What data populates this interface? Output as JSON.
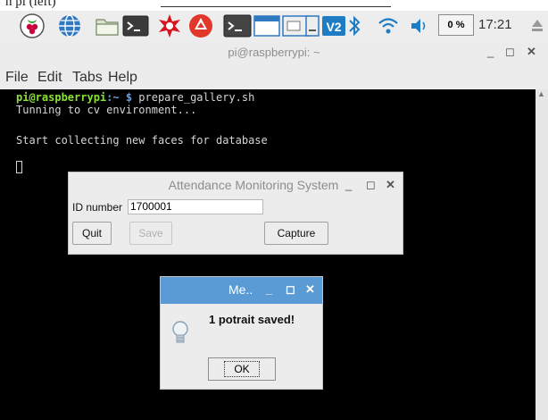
{
  "crop_text": "n pi (left)",
  "taskbar": {
    "cpu_usage": "0 %",
    "clock": "17:21",
    "vnc_label": "V2"
  },
  "terminal": {
    "title": "pi@raspberrypi: ~",
    "menu": [
      "File",
      "Edit",
      "Tabs",
      "Help"
    ],
    "prompt_user": "pi@raspberrypi",
    "prompt_path": ":~ $",
    "command": " prepare_gallery.sh",
    "lines": [
      "Tunning to cv environment...",
      "",
      "Start collecting new faces for database"
    ]
  },
  "attendance_dialog": {
    "title": "Attendance Monitoring System",
    "id_label": "ID number",
    "id_value": "1700001",
    "quit_label": "Quit",
    "save_label": "Save",
    "capture_label": "Capture"
  },
  "message_dialog": {
    "title": "Me..",
    "text": "1 potrait saved!",
    "ok_label": "OK"
  },
  "colors": {
    "message_titlebar": "#5b9bd5",
    "terminal_bg": "#000000",
    "prompt_user": "#8ae234",
    "prompt_path": "#729fcf"
  }
}
